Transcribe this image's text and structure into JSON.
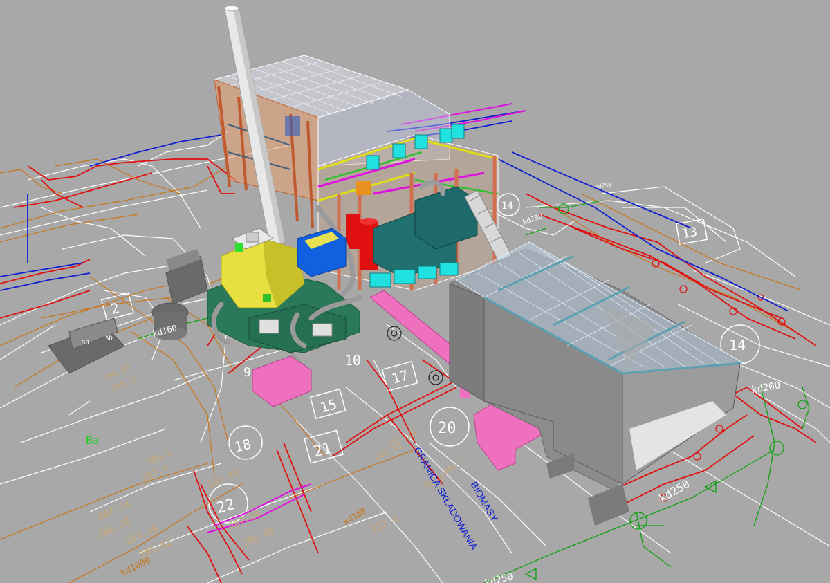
{
  "scene": {
    "background": "#a8a8a8",
    "colors": {
      "white_lines": "#ffffff",
      "red_pipes": "#e01010",
      "orange_lines": "#c87820",
      "blue_lines": "#1020d0",
      "green_lines": "#10a010",
      "magenta_lines": "#e010e0",
      "cyan_units": "#20e0e0",
      "pink_ducts": "#f070c0",
      "yellow_boiler": "#e8e040",
      "green_boiler": "#2a7a5a",
      "chimney": "#e8e8e8",
      "storage_gray": "#8c8c8c"
    }
  },
  "labels": {
    "plot_numbers": [
      "2",
      "13",
      "14",
      "14",
      "15",
      "18",
      "20",
      "21",
      "22",
      "17",
      "10",
      "9"
    ],
    "kd_labels": [
      "kd160",
      "kd200",
      "kd250",
      "kd160",
      "kd250",
      "kd1000",
      "kd250",
      "kd250"
    ],
    "green_label": "Ba",
    "elevations": [
      "287.24",
      "286.38",
      "287.30",
      "285.62",
      "287.4",
      "287.9",
      "286.5",
      "285.83",
      "287.20",
      "286.40",
      "285.53",
      "287.28",
      "286.33",
      "285.33",
      "286.2",
      "287.1"
    ],
    "boundary_text_line1": "GRANICA SKŁADOWANIA",
    "boundary_text_line2": "BIOMASY",
    "sign_text": "kd250",
    "misc": [
      "SD",
      "SD"
    ]
  }
}
